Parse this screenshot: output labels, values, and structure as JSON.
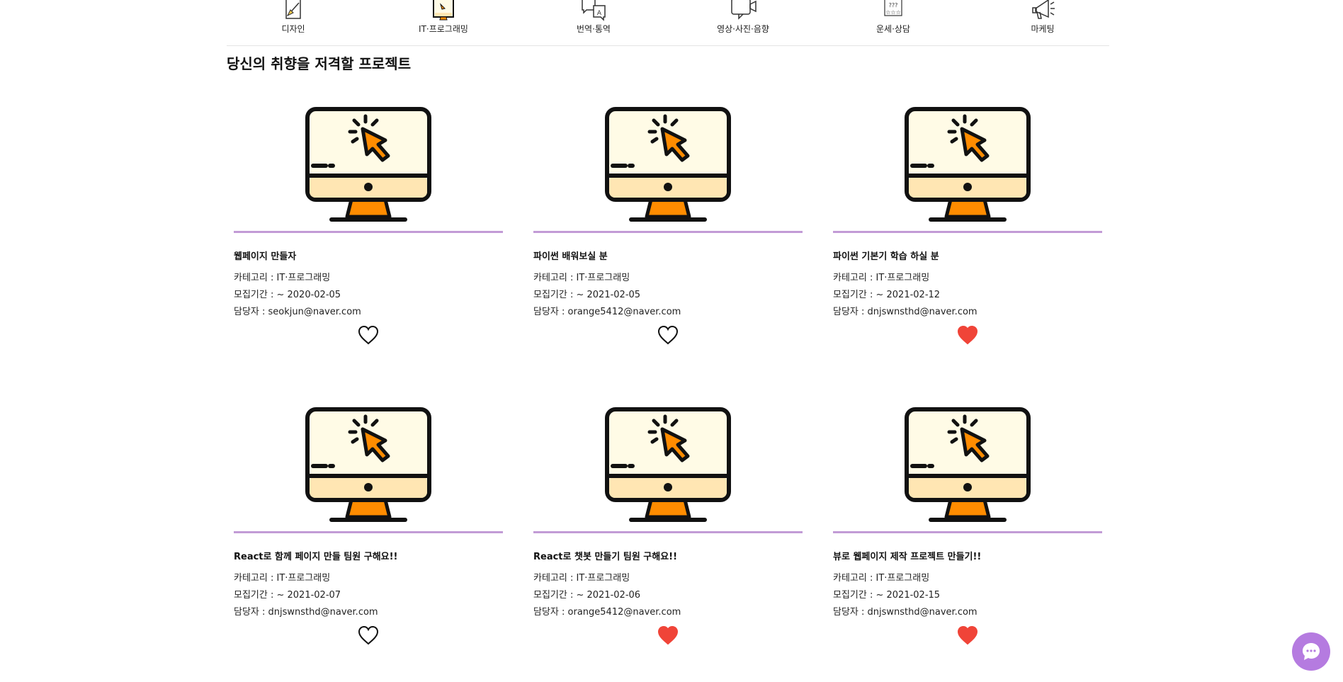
{
  "categories": [
    {
      "label": "디자인",
      "icon": "design-icon"
    },
    {
      "label": "IT·프로그래밍",
      "icon": "it-programming-icon"
    },
    {
      "label": "번역·통역",
      "icon": "translation-icon"
    },
    {
      "label": "영상·사진·음향",
      "icon": "video-photo-audio-icon"
    },
    {
      "label": "운세·상담",
      "icon": "fortune-counseling-icon"
    },
    {
      "label": "마케팅",
      "icon": "marketing-icon"
    }
  ],
  "section": {
    "title": "당신의 취향을 저격할 프로젝트"
  },
  "projects": [
    {
      "title": "웹페이지 만들자",
      "category": "카테고리 : IT·프로그래밍",
      "period": "모집기간 : ~ 2020-02-05",
      "manager": "담당자 : seokjun@naver.com",
      "liked": false
    },
    {
      "title": "파이썬 배워보실 분",
      "category": "카테고리 : IT·프로그래밍",
      "period": "모집기간 : ~ 2021-02-05",
      "manager": "담당자 : orange5412@naver.com",
      "liked": false
    },
    {
      "title": "파이썬 기본기 학습 하실 분",
      "category": "카테고리 : IT·프로그래밍",
      "period": "모집기간 : ~ 2021-02-12",
      "manager": "담당자 : dnjswnsthd@naver.com",
      "liked": true
    },
    {
      "title": "React로 함께 페이지 만들 팀원 구해요!!",
      "category": "카테고리 : IT·프로그래밍",
      "period": "모집기간 : ~ 2021-02-07",
      "manager": "담당자 : dnjswnsthd@naver.com",
      "liked": false
    },
    {
      "title": "React로 챗봇 만들기 팀원 구해요!!",
      "category": "카테고리 : IT·프로그래밍",
      "period": "모집기간 : ~ 2021-02-06",
      "manager": "담당자 : orange5412@naver.com",
      "liked": true
    },
    {
      "title": "뷰로 웹페이지 제작 프로젝트 만들기!!",
      "category": "카테고리 : IT·프로그래밍",
      "period": "모집기간 : ~ 2021-02-15",
      "manager": "담당자 : dnjswnsthd@naver.com",
      "liked": true
    }
  ],
  "colors": {
    "accent": "#c29bd6",
    "heart_liked": "#f04438",
    "chat_button": "#b57be0",
    "monitor_orange": "#ff8c00",
    "screen": "#fffbe6",
    "monitor_base": "#ffe6b3"
  }
}
